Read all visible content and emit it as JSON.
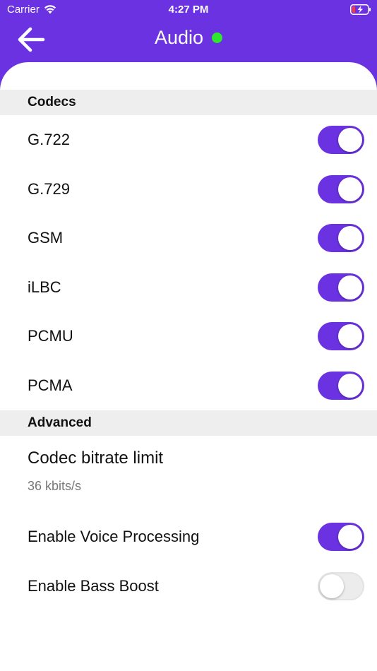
{
  "status_bar": {
    "carrier": "Carrier",
    "time": "4:27 PM"
  },
  "nav": {
    "title": "Audio",
    "status_color": "#2ee82e"
  },
  "colors": {
    "accent": "#6a32e0",
    "toggle_off": "#ececec",
    "section_bg": "#eeeeee"
  },
  "sections": {
    "codecs": {
      "title": "Codecs",
      "items": [
        {
          "label": "G.722",
          "enabled": true
        },
        {
          "label": "G.729",
          "enabled": true
        },
        {
          "label": "GSM",
          "enabled": true
        },
        {
          "label": "iLBC",
          "enabled": true
        },
        {
          "label": "PCMU",
          "enabled": true
        },
        {
          "label": "PCMA",
          "enabled": true
        }
      ]
    },
    "advanced": {
      "title": "Advanced",
      "bitrate": {
        "label": "Codec bitrate limit",
        "value": "36 kbits/s"
      },
      "items": [
        {
          "label": "Enable Voice Processing",
          "enabled": true
        },
        {
          "label": "Enable Bass Boost",
          "enabled": false
        }
      ]
    }
  }
}
